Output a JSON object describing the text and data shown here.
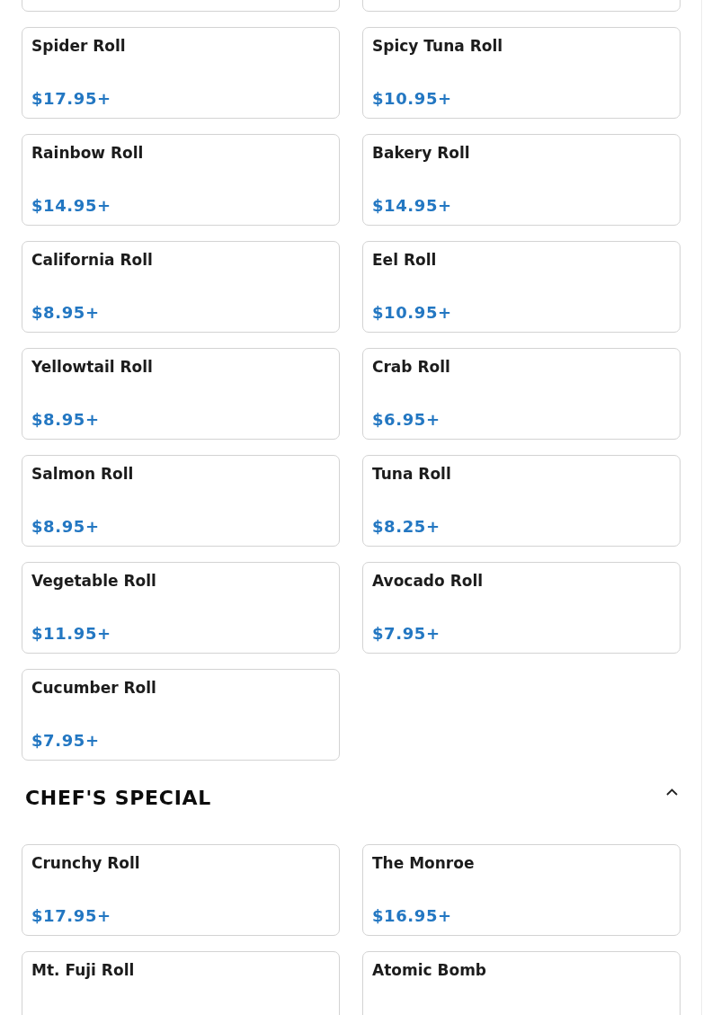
{
  "sections": [
    {
      "items": [
        {
          "kind": "clipped"
        },
        {
          "kind": "clipped"
        },
        {
          "kind": "item",
          "name": "Spider Roll",
          "price": "$17.95+"
        },
        {
          "kind": "item",
          "name": "Spicy Tuna Roll",
          "price": "$10.95+"
        },
        {
          "kind": "item",
          "name": "Rainbow Roll",
          "price": "$14.95+"
        },
        {
          "kind": "item",
          "name": "Bakery Roll",
          "price": "$14.95+"
        },
        {
          "kind": "item",
          "name": "California Roll",
          "price": "$8.95+"
        },
        {
          "kind": "item",
          "name": "Eel Roll",
          "price": "$10.95+"
        },
        {
          "kind": "item",
          "name": "Yellowtail Roll",
          "price": "$8.95+"
        },
        {
          "kind": "item",
          "name": "Crab Roll",
          "price": "$6.95+"
        },
        {
          "kind": "item",
          "name": "Salmon Roll",
          "price": "$8.95+"
        },
        {
          "kind": "item",
          "name": "Tuna Roll",
          "price": "$8.25+"
        },
        {
          "kind": "item",
          "name": "Vegetable Roll",
          "price": "$11.95+"
        },
        {
          "kind": "item",
          "name": "Avocado Roll",
          "price": "$7.95+"
        },
        {
          "kind": "item",
          "name": "Cucumber Roll",
          "price": "$7.95+"
        }
      ]
    },
    {
      "title": "CHEF'S SPECIAL",
      "expanded": true,
      "items": [
        {
          "kind": "item",
          "name": "Crunchy Roll",
          "price": "$17.95+"
        },
        {
          "kind": "item",
          "name": "The Monroe",
          "price": "$16.95+"
        },
        {
          "kind": "item",
          "name": "Mt. Fuji Roll"
        },
        {
          "kind": "item",
          "name": "Atomic Bomb"
        }
      ]
    }
  ]
}
